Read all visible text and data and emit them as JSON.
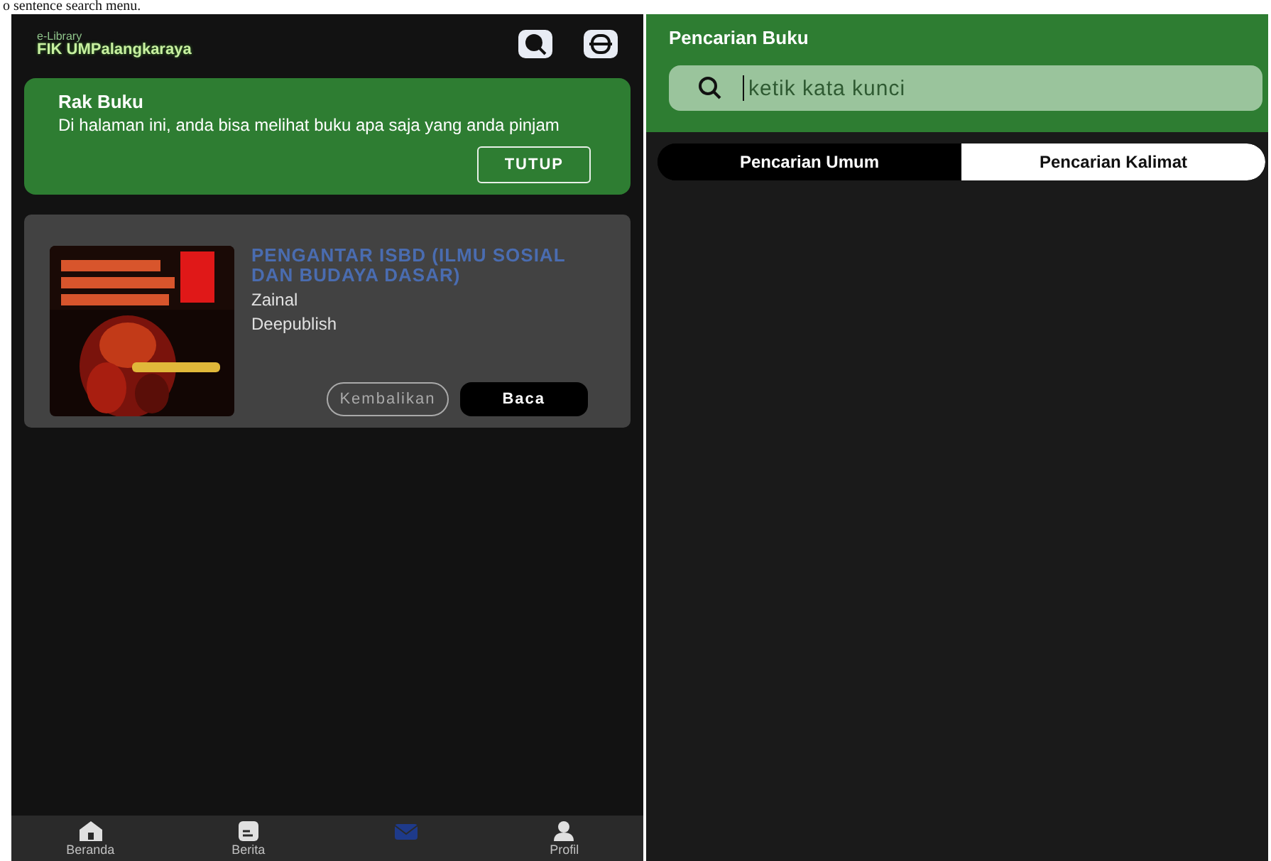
{
  "caption": "o sentence search menu.",
  "left_screen": {
    "logo": {
      "small": "e-Library",
      "main": "FIK UMPalangkaraya"
    },
    "info_card": {
      "title": "Rak Buku",
      "text": "Di halaman ini, anda bisa melihat buku apa saja yang anda pinjam",
      "button": "TUTUP"
    },
    "books": [
      {
        "title": "PENGANTAR ISBD  (ILMU SOSIAL DAN BUDAYA DASAR)",
        "author": "Zainal",
        "publisher": "Deepublish",
        "buttons": [
          "Kembalikan",
          "Baca"
        ]
      }
    ],
    "nav": [
      {
        "kind": "home",
        "label": "Beranda",
        "selected": false
      },
      {
        "kind": "news",
        "label": "Berita",
        "selected": false
      },
      {
        "kind": "mail",
        "selected": true
      },
      {
        "kind": "profile",
        "label": "Profil",
        "selected": false
      }
    ]
  },
  "right_screen": {
    "title": "Pencarian Buku",
    "search": {
      "placeholder": "ketik kata kunci"
    },
    "tabs": [
      {
        "label": "Pencarian Umum",
        "selected": false
      },
      {
        "label": "Pencarian Kalimat",
        "selected": true
      }
    ]
  }
}
